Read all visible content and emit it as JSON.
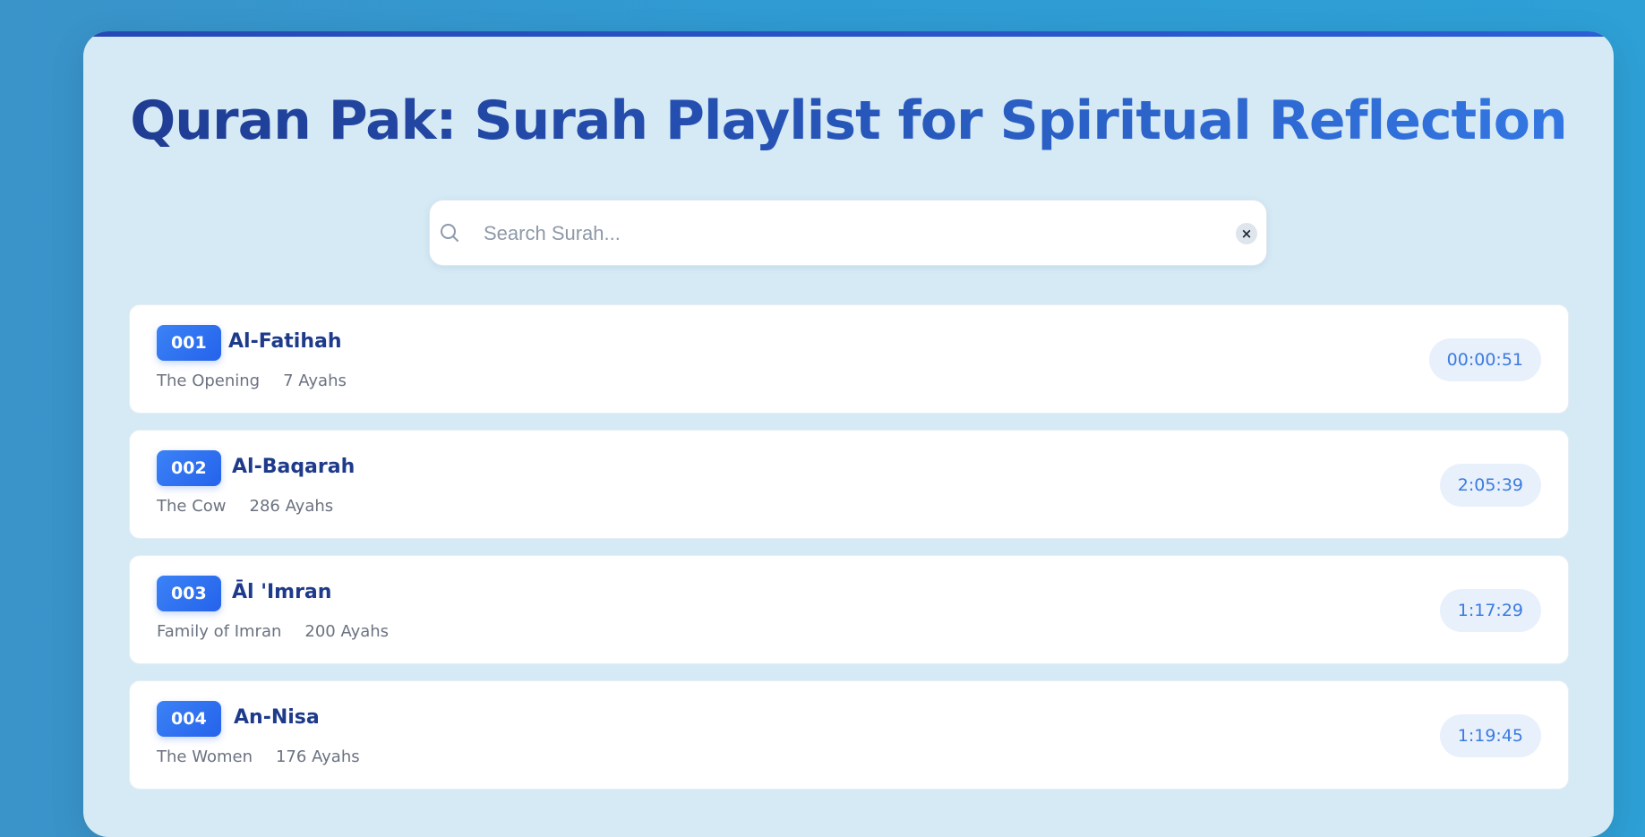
{
  "title": "Quran Pak: Surah Playlist for Spiritual Reflection",
  "search": {
    "placeholder": "Search Surah...",
    "value": "",
    "clear_label": "×"
  },
  "surahs": [
    {
      "number": "001",
      "name": "Al-Fatihah",
      "meaning": "The Opening",
      "ayahs": "7 Ayahs",
      "duration": "00:00:51"
    },
    {
      "number": "002",
      "name": "Al-Baqarah",
      "meaning": "The Cow",
      "ayahs": "286 Ayahs",
      "duration": "2:05:39"
    },
    {
      "number": "003",
      "name": "Āl 'Imran",
      "meaning": "Family of Imran",
      "ayahs": "200 Ayahs",
      "duration": "1:17:29"
    },
    {
      "number": "004",
      "name": "An-Nisa",
      "meaning": "The Women",
      "ayahs": "176 Ayahs",
      "duration": "1:19:45"
    }
  ],
  "colors": {
    "background": "#2f9bd3",
    "card": "#d6eaf5",
    "accent": "#2563eb",
    "title_dark": "#1f3b91",
    "title_light": "#3479e6"
  },
  "icons": {
    "search": "search-icon",
    "clear": "close-icon"
  }
}
